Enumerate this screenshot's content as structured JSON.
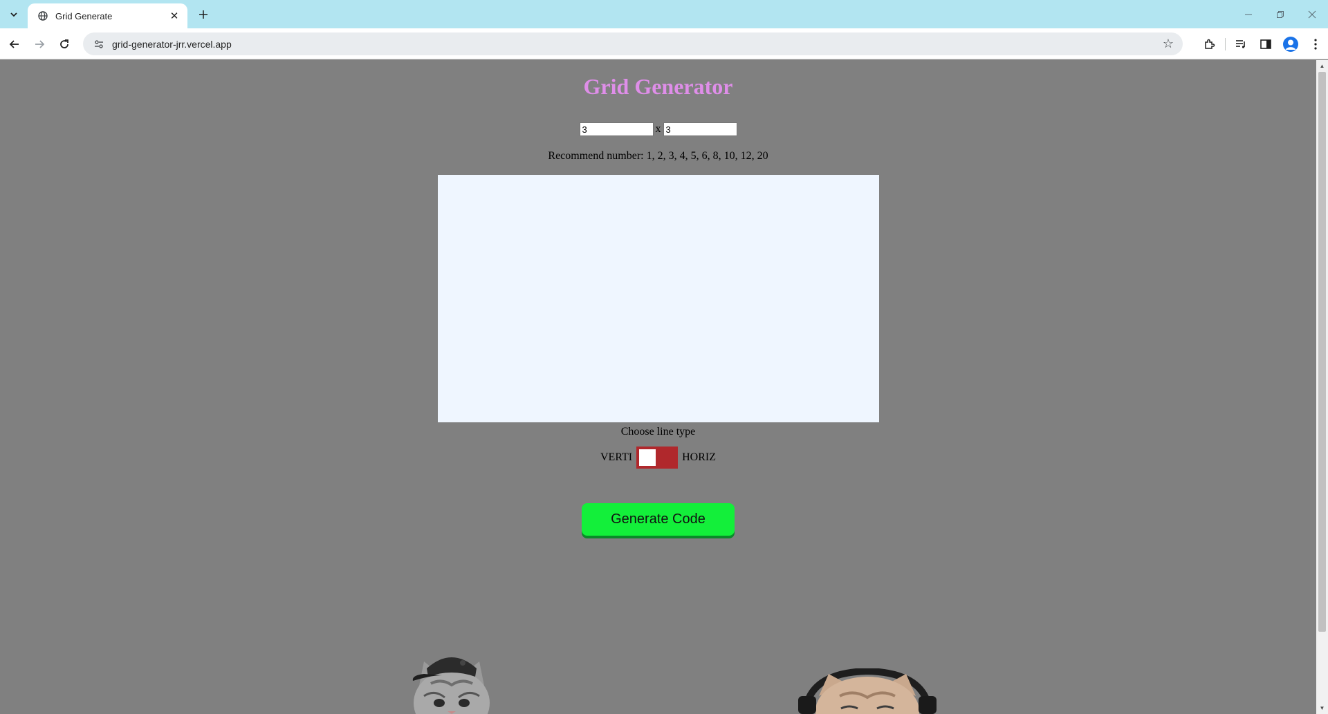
{
  "browser": {
    "tab": {
      "title": "Grid Generate"
    },
    "url": "grid-generator-jrr.vercel.app"
  },
  "page": {
    "title": "Grid Generator",
    "rows_value": "3",
    "times_sign": "x",
    "cols_value": "3",
    "recommend_text": "Recommend number: 1, 2, 3, 4, 5, 6, 8, 10, 12, 20",
    "line_type_label": "Choose line type",
    "toggle_left_label": "VERTI",
    "toggle_right_label": "HORIZ",
    "generate_button_label": "Generate Code"
  },
  "colors": {
    "page_background": "#808080",
    "title": "#df8ee9",
    "grid_preview": "#eff6ff",
    "toggle": "#b0282c",
    "generate_button": "#13ef3a"
  }
}
